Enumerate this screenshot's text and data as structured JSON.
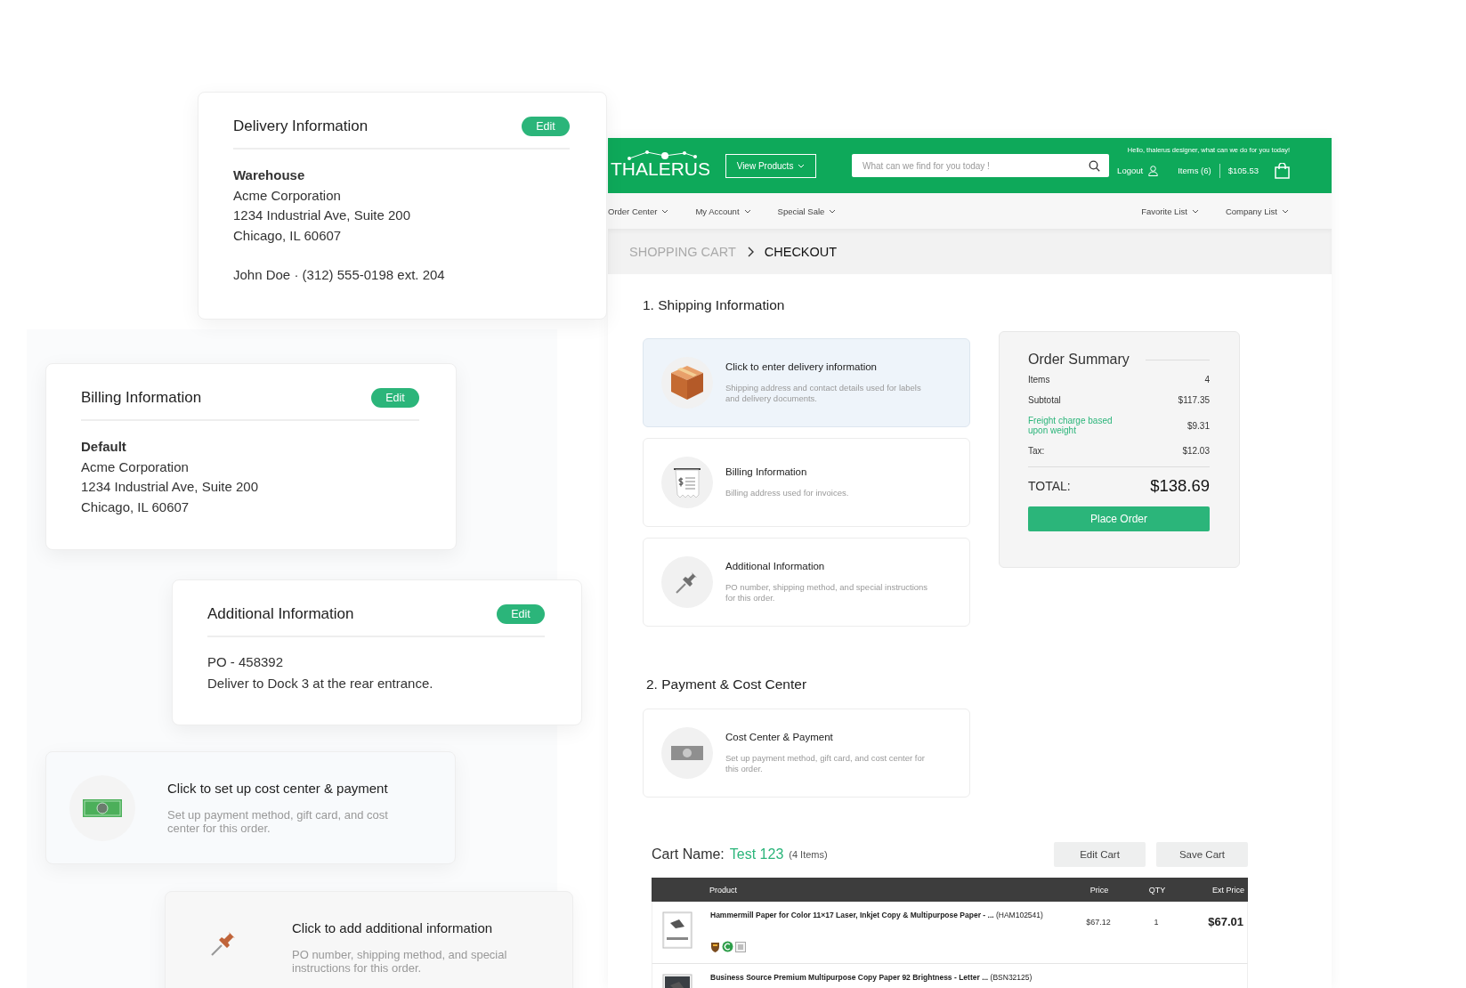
{
  "page": {
    "header": {
      "logo": "THALERUS",
      "view_products": "View Products",
      "search_placeholder": "What can we find for you today !",
      "greeting": "Hello, thalerus designer, what can we do for you today!",
      "logout": "Logout",
      "items": "Items (6)",
      "total": "$105.53"
    },
    "nav": {
      "left": [
        "Order Center",
        "My Account",
        "Special Sale"
      ],
      "right": [
        "Favorite List",
        "Company List"
      ]
    },
    "breadcrumb": [
      {
        "label": "SHOPPING CART",
        "current": false
      },
      {
        "label": "CHECKOUT",
        "current": true
      }
    ],
    "shipping_heading": "1. Shipping Information",
    "shipping_cards": [
      {
        "kind": "box",
        "title": "Click to enter delivery information",
        "description": "Shipping address and contact details used for labels and delivery documents.",
        "selected": true
      },
      {
        "kind": "receipt",
        "title": "Billing Information",
        "description": "Billing address used for invoices.",
        "selected": false
      },
      {
        "kind": "pin",
        "title": "Additional Information",
        "description": "PO number, shipping method, and special instructions for this order.",
        "selected": false
      }
    ],
    "order_summary": {
      "title": "Order Summary",
      "rows": [
        {
          "label": "Items",
          "value": "4",
          "kind": "plain"
        },
        {
          "label": "Subtotal",
          "value": "$117.35",
          "kind": "plain"
        },
        {
          "label": "Freight charge based upon weight",
          "value": "$9.31",
          "kind": "link"
        },
        {
          "label": "Tax:",
          "value": "$12.03",
          "kind": "plain"
        }
      ],
      "total_label": "TOTAL:",
      "total_value": "$138.69",
      "button": "Place Order"
    },
    "payment_heading": "2. Payment & Cost Center",
    "payment_cards": [
      {
        "kind": "bill",
        "title": "Cost Center & Payment",
        "description": "Set up payment method, gift card, and cost center for this order.",
        "selected": false
      }
    ],
    "cart": {
      "label": "Cart Name:",
      "name": "Test 123",
      "count": "(4 Items)",
      "buttons": [
        "Edit Cart",
        "Save Cart"
      ],
      "columns": [
        "Product",
        "Price",
        "QTY",
        "Ext Price"
      ],
      "rows": [
        {
          "product": "Hammermill Paper for Color 11×17 Laser, Inkjet Copy & Multipurpose Paper - ...",
          "sku": "(HAM102541)",
          "price": "$67.12",
          "qty": "1",
          "ext_price": "$67.01"
        },
        {
          "product": "Business Source Premium Multipurpose Copy Paper 92 Brightness - Letter ...",
          "sku": "(BSN32125)"
        }
      ]
    }
  },
  "delivery_card": {
    "title": "Delivery Information",
    "edit": "Edit",
    "name": "Warehouse",
    "lines": [
      "Acme Corporation",
      "1234 Industrial Ave, Suite 200",
      "Chicago, IL 60607"
    ],
    "contact": "John Doe · (312) 555-0198 ext. 204"
  },
  "billing_card": {
    "title": "Billing Information",
    "edit": "Edit",
    "name": "Default",
    "lines": [
      "Acme Corporation",
      "1234 Industrial Ave, Suite 200",
      "Chicago, IL 60607"
    ]
  },
  "additional_card": {
    "title": "Additional Information",
    "edit": "Edit",
    "lines": [
      "PO - 458392",
      "Deliver to Dock 3 at the rear entrance."
    ]
  },
  "prompt_cards": [
    {
      "kind": "bill",
      "title": "Click to set up cost center & payment",
      "description": "Set up payment method, gift card, and cost center for this order."
    },
    {
      "kind": "pin",
      "title": "Click to add additional information",
      "description": "PO number, shipping method, and special instructions for this order."
    }
  ]
}
